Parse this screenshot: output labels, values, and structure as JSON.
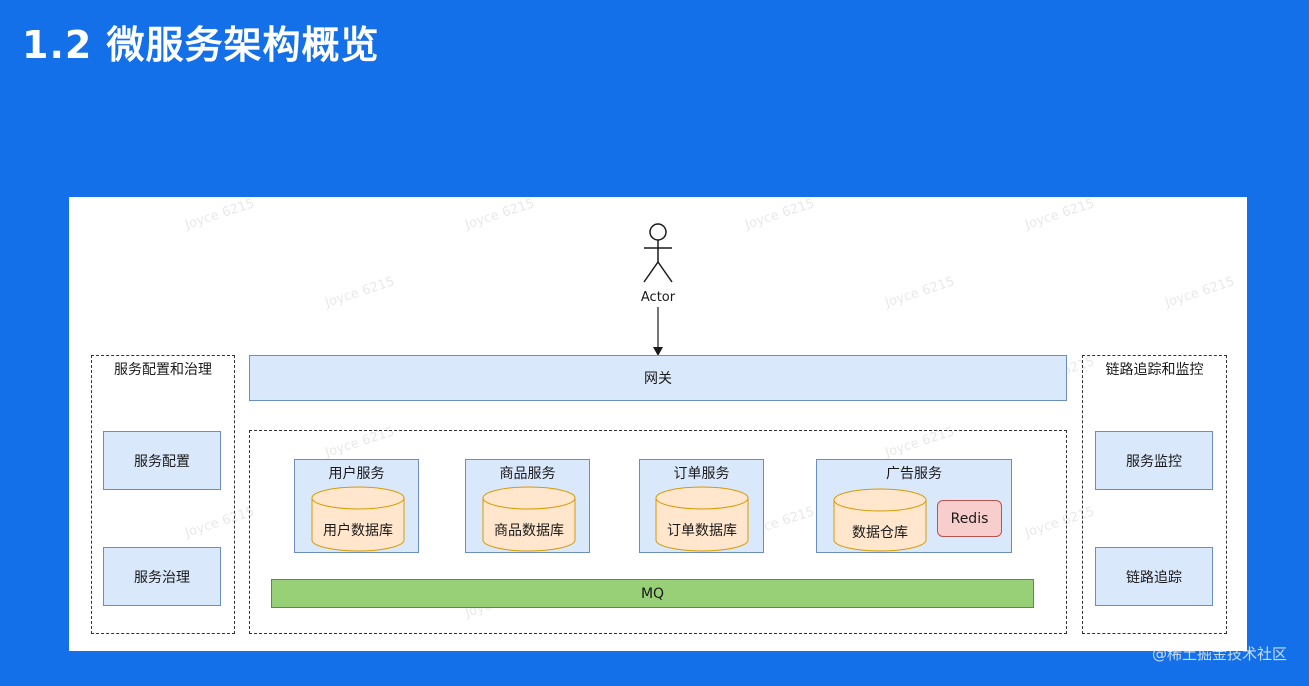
{
  "slide": {
    "title": "1.2 微服务架构概览"
  },
  "diagram": {
    "actor_label": "Actor",
    "gateway_label": "网关",
    "left_panel": {
      "title": "服务配置和治理",
      "items": [
        "服务配置",
        "服务治理"
      ]
    },
    "right_panel": {
      "title": "链路追踪和监控",
      "items": [
        "服务监控",
        "链路追踪"
      ]
    },
    "services": [
      {
        "title": "用户服务",
        "db": "用户数据库"
      },
      {
        "title": "商品服务",
        "db": "商品数据库"
      },
      {
        "title": "订单服务",
        "db": "订单数据库"
      },
      {
        "title": "广告服务",
        "db": "数据仓库",
        "cache": "Redis"
      }
    ],
    "mq_label": "MQ",
    "watermark_text": "Joyce 6215"
  },
  "footer": {
    "watermark": "@稀土掘金技术社区"
  },
  "colors": {
    "background": "#1470e8",
    "blue_fill": "#dae8fc",
    "blue_stroke": "#6c8ebf",
    "db_fill": "#ffe6cc",
    "db_stroke": "#d79b00",
    "redis_fill": "#f8cecc",
    "mq_fill": "#97d077"
  }
}
